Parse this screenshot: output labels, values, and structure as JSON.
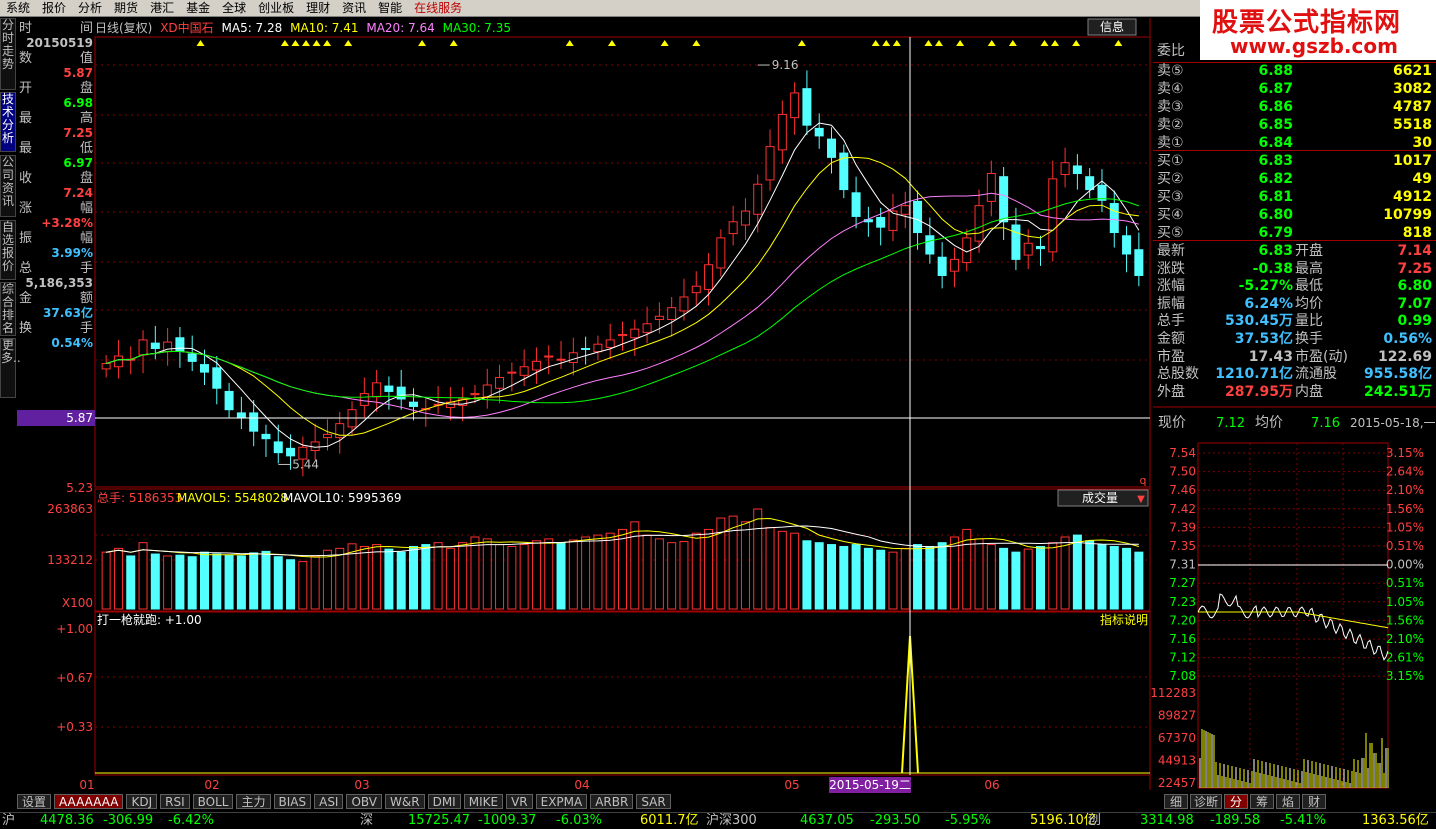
{
  "menu": [
    "系统",
    "报价",
    "分析",
    "期货",
    "港汇",
    "基金",
    "全球",
    "创业板",
    "理财",
    "资讯",
    "智能",
    "在线服务"
  ],
  "logo": {
    "line1": "股票公式指标网",
    "line2": "www.gszb.com"
  },
  "left_nav": [
    "分时走势",
    "技术分析",
    "公司资讯",
    "自选报价",
    "综合排名",
    "更多.."
  ],
  "info_panel": [
    {
      "l": "时",
      "r": "间"
    },
    {
      "v": "20150519",
      "c": "#c0c0c0"
    },
    {
      "l": "数",
      "r": "值"
    },
    {
      "v": "5.87",
      "c": "#ff4040"
    },
    {
      "l": "开",
      "r": "盘"
    },
    {
      "v": "6.98",
      "c": "#00ff00"
    },
    {
      "l": "最",
      "r": "高"
    },
    {
      "v": "7.25",
      "c": "#ff4040"
    },
    {
      "l": "最",
      "r": "低"
    },
    {
      "v": "6.97",
      "c": "#00ff00"
    },
    {
      "l": "收",
      "r": "盘"
    },
    {
      "v": "7.24",
      "c": "#ff4040"
    },
    {
      "l": "涨",
      "r": "幅"
    },
    {
      "v": "+3.28%",
      "c": "#ff4040"
    },
    {
      "l": "振",
      "r": "幅"
    },
    {
      "v": "3.99%",
      "c": "#40c0ff"
    },
    {
      "l": "总",
      "r": "手"
    },
    {
      "v": "5,186,353",
      "c": "#c0c0c0"
    },
    {
      "l": "金",
      "r": "额"
    },
    {
      "v": "37.63亿",
      "c": "#40c0ff"
    },
    {
      "l": "换",
      "r": "手"
    },
    {
      "v": "0.54%",
      "c": "#40c0ff"
    }
  ],
  "kline_header": {
    "period": "日线(复权)",
    "name": "XD中国石",
    "ma5": "MA5: 7.28",
    "ma10": "MA10: 7.41",
    "ma20": "MA20: 7.64",
    "ma30": "MA30: 7.35"
  },
  "main_chart": {
    "crosshair_value": "5.87",
    "price_high_label": "9.16",
    "price_low_label": "5.44",
    "axis_bottom": "5.23",
    "info_btn": "信息"
  },
  "volume_panel": {
    "header_total": "总手: 5186353",
    "mavol5": "MAVOL5: 5548028",
    "mavol10": "MAVOL10: 5995369",
    "dropdown": "成交量",
    "ticks": [
      "263863",
      "133212"
    ],
    "unit": "X100"
  },
  "indicator_panel": {
    "header": "打一枪就跑: +1.00",
    "explain": "指标说明",
    "ticks": [
      "+1.00",
      "+0.67",
      "+0.33"
    ]
  },
  "x_axis": {
    "labels": [
      "01",
      "02",
      "03",
      "04",
      "05",
      "06"
    ],
    "cursor_date": "2015-05-19二"
  },
  "order_book": {
    "title": "委比",
    "sells": [
      {
        "label": "卖⑤",
        "price": "6.88",
        "vol": "6621"
      },
      {
        "label": "卖④",
        "price": "6.87",
        "vol": "3082"
      },
      {
        "label": "卖③",
        "price": "6.86",
        "vol": "4787"
      },
      {
        "label": "卖②",
        "price": "6.85",
        "vol": "5518"
      },
      {
        "label": "卖①",
        "price": "6.84",
        "vol": "30"
      }
    ],
    "buys": [
      {
        "label": "买①",
        "price": "6.83",
        "vol": "1017"
      },
      {
        "label": "买②",
        "price": "6.82",
        "vol": "49"
      },
      {
        "label": "买③",
        "price": "6.81",
        "vol": "4912"
      },
      {
        "label": "买④",
        "price": "6.80",
        "vol": "10799"
      },
      {
        "label": "买⑤",
        "price": "6.79",
        "vol": "818"
      }
    ]
  },
  "quote": [
    {
      "l1": "最新",
      "v1": "6.83",
      "c1": "#00ff00",
      "l2": "开盘",
      "v2": "7.14",
      "c2": "#ff4040"
    },
    {
      "l1": "涨跌",
      "v1": "-0.38",
      "c1": "#00ff00",
      "l2": "最高",
      "v2": "7.25",
      "c2": "#ff4040"
    },
    {
      "l1": "涨幅",
      "v1": "-5.27%",
      "c1": "#00ff00",
      "l2": "最低",
      "v2": "6.80",
      "c2": "#00ff00"
    },
    {
      "l1": "振幅",
      "v1": "6.24%",
      "c1": "#40c0ff",
      "l2": "均价",
      "v2": "7.07",
      "c2": "#00ff00"
    },
    {
      "l1": "总手",
      "v1": "530.45万",
      "c1": "#40c0ff",
      "l2": "量比",
      "v2": "0.99",
      "c2": "#00ff00"
    },
    {
      "l1": "金额",
      "v1": "37.53亿",
      "c1": "#40c0ff",
      "l2": "换手",
      "v2": "0.56%",
      "c2": "#40c0ff"
    },
    {
      "l1": "市盈",
      "v1": "17.43",
      "c1": "#c0c0c0",
      "l2": "市盈(动)",
      "v2": "122.69",
      "c2": "#c0c0c0"
    },
    {
      "l1": "总股数",
      "v1": "1210.71亿",
      "c1": "#40c0ff",
      "l2": "流通股",
      "v2": "955.58亿",
      "c2": "#40c0ff"
    },
    {
      "l1": "外盘",
      "v1": "287.95万",
      "c1": "#ff4040",
      "l2": "内盘",
      "v2": "242.51万",
      "c2": "#00ff00"
    }
  ],
  "mini": {
    "now_label": "现价",
    "now_val": "7.12",
    "avg_label": "均价",
    "avg_val": "7.16",
    "date": "2015-05-18,一",
    "prices": [
      "7.54",
      "7.50",
      "7.46",
      "7.42",
      "7.39",
      "7.35",
      "7.31",
      "7.27",
      "7.23",
      "7.20",
      "7.16",
      "7.12",
      "7.08"
    ],
    "pcts": [
      "3.15%",
      "2.64%",
      "2.10%",
      "1.56%",
      "1.05%",
      "0.51%",
      "0.00%",
      "0.51%",
      "1.05%",
      "1.56%",
      "2.10%",
      "2.61%",
      "3.15%"
    ],
    "vols": [
      "112283",
      "89827",
      "67370",
      "44913",
      "22457"
    ]
  },
  "bottom_tabs": [
    "设置",
    "AAAAAAA",
    "KDJ",
    "RSI",
    "BOLL",
    "主力",
    "BIAS",
    "ASI",
    "OBV",
    "W&R",
    "DMI",
    "MIKE",
    "VR",
    "EXPMA",
    "ARBR",
    "SAR"
  ],
  "right_tabs": [
    "细",
    "诊断",
    "分",
    "筹",
    "焰",
    "财"
  ],
  "status": [
    {
      "t": "沪",
      "c": "#c0c0c0"
    },
    {
      "t": "4478.36",
      "c": "#00ff00"
    },
    {
      "t": "-306.99",
      "c": "#00ff00"
    },
    {
      "t": "-6.42%",
      "c": "#00ff00"
    },
    {
      "t": "深",
      "c": "#c0c0c0"
    },
    {
      "t": "15725.47",
      "c": "#00ff00"
    },
    {
      "t": "-1009.37",
      "c": "#00ff00"
    },
    {
      "t": "-6.03%",
      "c": "#00ff00"
    },
    {
      "t": "6011.7亿",
      "c": "#ffff00"
    },
    {
      "t": "沪深300",
      "c": "#c0c0c0"
    },
    {
      "t": "4637.05",
      "c": "#00ff00"
    },
    {
      "t": "-293.50",
      "c": "#00ff00"
    },
    {
      "t": "-5.95%",
      "c": "#00ff00"
    },
    {
      "t": "5196.10亿",
      "c": "#ffff00"
    },
    {
      "t": "创",
      "c": "#c0c0c0"
    },
    {
      "t": "3314.98",
      "c": "#00ff00"
    },
    {
      "t": "-189.58",
      "c": "#00ff00"
    },
    {
      "t": "-5.41%",
      "c": "#00ff00"
    },
    {
      "t": "1363.56亿",
      "c": "#ffff00"
    }
  ],
  "chart_data": {
    "type": "candlestick",
    "period": "daily",
    "ma_legend": {
      "MA5": 7.28,
      "MA10": 7.41,
      "MA20": 7.64,
      "MA30": 7.35
    },
    "yaxis_labels": [
      "5.87",
      "5.23"
    ],
    "annotations": {
      "high": 9.16,
      "low": 5.44
    },
    "close": [
      6.38,
      6.45,
      6.42,
      6.6,
      6.52,
      6.58,
      6.5,
      6.4,
      6.3,
      6.15,
      5.95,
      5.88,
      5.75,
      5.68,
      5.55,
      5.52,
      5.6,
      5.65,
      5.72,
      5.82,
      5.95,
      6.1,
      6.2,
      6.12,
      6.05,
      5.98,
      5.96,
      6.0,
      6.02,
      6.05,
      6.1,
      6.18,
      6.25,
      6.3,
      6.35,
      6.4,
      6.45,
      6.42,
      6.48,
      6.52,
      6.56,
      6.6,
      6.65,
      6.7,
      6.75,
      6.82,
      6.9,
      7.0,
      7.1,
      7.3,
      7.55,
      7.7,
      7.8,
      8.05,
      8.4,
      8.7,
      8.9,
      8.6,
      8.5,
      8.3,
      8.0,
      7.75,
      7.7,
      7.65,
      7.8,
      7.85,
      7.6,
      7.4,
      7.2,
      7.35,
      7.55,
      7.85,
      8.15,
      7.7,
      7.35,
      7.5,
      7.45,
      8.1,
      8.25,
      8.15,
      8.0,
      7.9,
      7.6,
      7.4,
      7.2
    ],
    "volume": [
      150000,
      160000,
      140000,
      175000,
      145000,
      140000,
      142000,
      138000,
      150000,
      145000,
      142000,
      140000,
      148000,
      152000,
      138000,
      130000,
      125000,
      140000,
      155000,
      160000,
      172000,
      165000,
      170000,
      158000,
      150000,
      165000,
      170000,
      175000,
      160000,
      175000,
      190000,
      185000,
      170000,
      165000,
      170000,
      180000,
      185000,
      175000,
      182000,
      190000,
      195000,
      200000,
      210000,
      230000,
      195000,
      185000,
      175000,
      178000,
      200000,
      210000,
      240000,
      245000,
      230000,
      263863,
      215000,
      205000,
      200000,
      180000,
      175000,
      170000,
      165000,
      170000,
      160000,
      155000,
      150000,
      160000,
      170000,
      165000,
      175000,
      190000,
      210000,
      185000,
      170000,
      160000,
      150000,
      158000,
      165000,
      175000,
      190000,
      195000,
      180000,
      170000,
      165000,
      160000,
      150000
    ],
    "indicator": {
      "name": "打一枪就跑",
      "signal_date": "2015-05-19",
      "value": 1.0
    }
  }
}
